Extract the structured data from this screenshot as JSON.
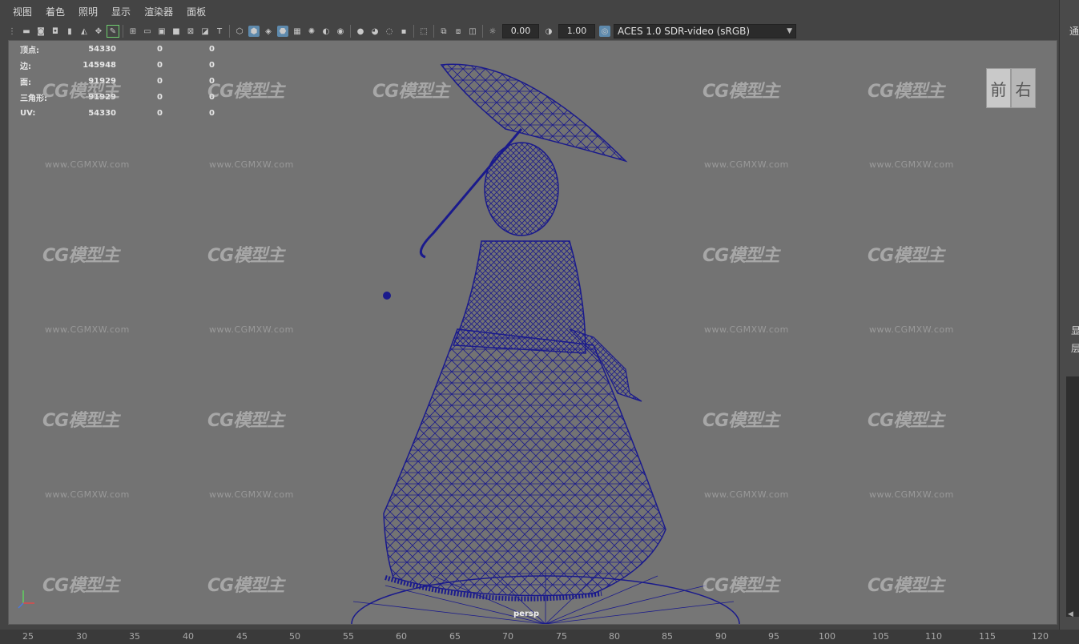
{
  "menu": [
    "视图",
    "着色",
    "照明",
    "显示",
    "渲染器",
    "面板"
  ],
  "toolbar": {
    "near_value": "0.00",
    "far_value": "1.00",
    "color_space": "ACES 1.0 SDR-video (sRGB)"
  },
  "stats": [
    {
      "label": "顶点:",
      "v1": "54330",
      "v2": "0",
      "v3": "0"
    },
    {
      "label": "边:",
      "v1": "145948",
      "v2": "0",
      "v3": "0"
    },
    {
      "label": "面:",
      "v1": "91929",
      "v2": "0",
      "v3": "0"
    },
    {
      "label": "三角形:",
      "v1": "91929",
      "v2": "0",
      "v3": "0"
    },
    {
      "label": "UV:",
      "v1": "54330",
      "v2": "0",
      "v3": "0"
    }
  ],
  "viewcube": {
    "front": "前",
    "right": "右"
  },
  "camera_label": "persp",
  "watermark": {
    "logo": "CG模型主",
    "url": "www.CGMXW.com"
  },
  "ruler": [
    "25",
    "30",
    "35",
    "40",
    "45",
    "50",
    "55",
    "60",
    "65",
    "70",
    "75",
    "80",
    "85",
    "90",
    "95",
    "100",
    "105",
    "110",
    "115",
    "120"
  ],
  "right_panel": {
    "t1": "通",
    "t2": "显",
    "t3": "层"
  },
  "colors": {
    "wire": "#1a1a8c",
    "viewport_bg": "#737373"
  }
}
